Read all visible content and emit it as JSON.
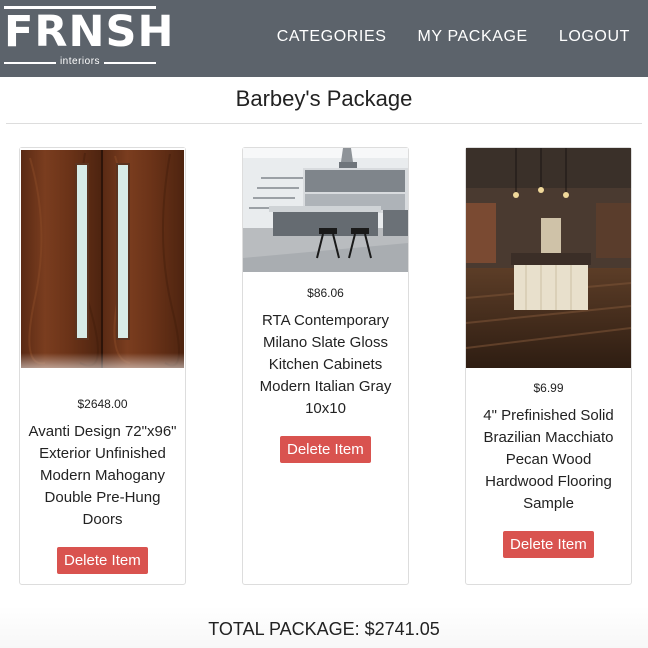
{
  "brand": {
    "name": "FRNSH",
    "sub": "interiors"
  },
  "nav": {
    "links": [
      "CATEGORIES",
      "MY PACKAGE",
      "LOGOUT"
    ]
  },
  "page": {
    "title": "Barbey's Package"
  },
  "items": [
    {
      "price": "$2648.00",
      "name": "Avanti Design 72\"x96\" Exterior Unfinished Modern Mahogany Double Pre-Hung Doors",
      "button": "Delete Item",
      "image": "mahogany-double-door"
    },
    {
      "price": "$86.06",
      "name": "RTA Contemporary Milano Slate Gloss Kitchen Cabinets Modern Italian Gray 10x10",
      "button": "Delete Item",
      "image": "gray-kitchen-cabinets"
    },
    {
      "price": "$6.99",
      "name": "4\" Prefinished Solid Brazilian Macchiato Pecan Wood Hardwood Flooring Sample",
      "button": "Delete Item",
      "image": "hardwood-floor-kitchen"
    }
  ],
  "total": "TOTAL PACKAGE: $2741.05",
  "colors": {
    "navbar": "#5c636b",
    "delete": "#d9534f",
    "border": "#dddddd"
  }
}
